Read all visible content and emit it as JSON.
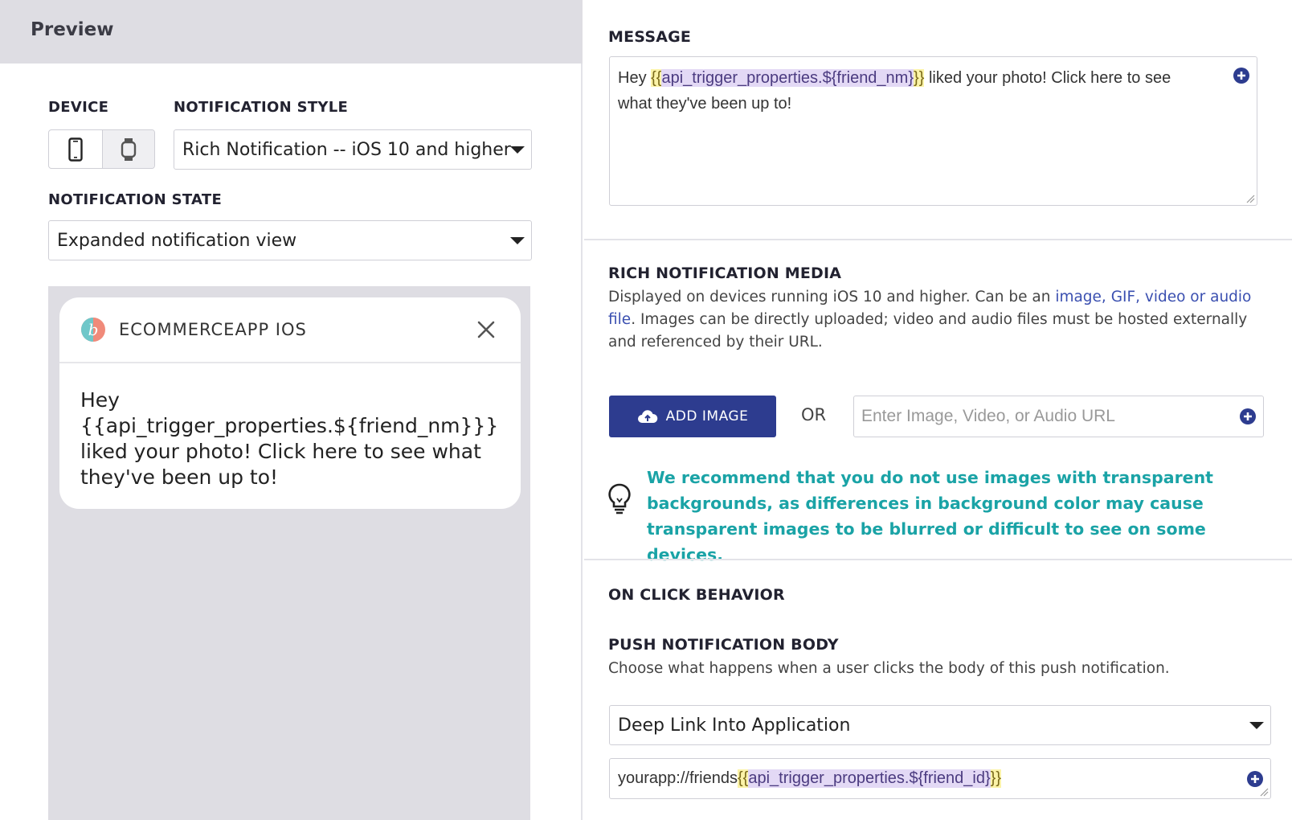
{
  "preview": {
    "title": "Preview",
    "device_label": "DEVICE",
    "notification_style_label": "NOTIFICATION STYLE",
    "notification_style_value": "Rich Notification -- iOS 10 and higher",
    "notification_state_label": "NOTIFICATION STATE",
    "notification_state_value": "Expanded notification view",
    "devices": [
      {
        "name": "phone",
        "icon": "phone-icon",
        "active": true
      },
      {
        "name": "watch",
        "icon": "watch-icon",
        "active": false
      }
    ],
    "card": {
      "app_name": "ECOMMERCEAPP IOS",
      "body": "Hey {{api_trigger_properties.${friend_nm}}} liked your photo! Click here to see what they've been up to!"
    }
  },
  "message": {
    "label": "MESSAGE",
    "text_before": "Hey ",
    "brace_open": "{{",
    "variable": "api_trigger_properties.${friend_nm}",
    "brace_close": "}}",
    "text_after": " liked your photo! Click here to see what they've been up to!"
  },
  "rich_media": {
    "label": "RICH NOTIFICATION MEDIA",
    "desc_part1": "Displayed on devices running iOS 10 and higher. Can be an ",
    "desc_link": "image, GIF, video or audio file",
    "desc_part2": ". Images can be directly uploaded; video and audio files must be hosted externally and referenced by their URL.",
    "add_image_label": "ADD IMAGE",
    "or_label": "OR",
    "url_placeholder": "Enter Image, Video, or Audio URL",
    "tip": "We recommend that you do not use images with transparent backgrounds, as differences in background color may cause transparent images to be blurred or difficult to see on some devices."
  },
  "on_click": {
    "label": "ON CLICK BEHAVIOR",
    "push_body_label": "PUSH NOTIFICATION BODY",
    "push_body_desc": "Choose what happens when a user clicks the body of this push notification.",
    "action_value": "Deep Link Into Application",
    "deep_link_prefix": "yourapp://friends",
    "deep_link_brace_open": "{{",
    "deep_link_variable": "api_trigger_properties.${friend_id}",
    "deep_link_brace_close": "}}"
  },
  "colors": {
    "primary": "#2d3c8f",
    "tip": "#1aa3a6",
    "link": "#3a4fb0",
    "panel_gray": "#dedde3"
  }
}
